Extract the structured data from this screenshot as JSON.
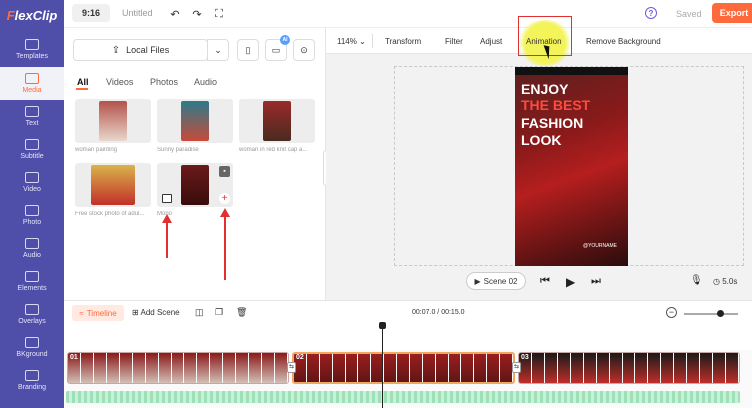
{
  "app": {
    "logo_prefix": "F",
    "logo_rest": "lexClip"
  },
  "topbar": {
    "ratio": "9:16",
    "title": "Untitled",
    "help": "?",
    "saved": "Saved",
    "export": "Export"
  },
  "sidebar": {
    "items": [
      {
        "label": "Templates"
      },
      {
        "label": "Media"
      },
      {
        "label": "Text"
      },
      {
        "label": "Subtitle"
      },
      {
        "label": "Video"
      },
      {
        "label": "Photo"
      },
      {
        "label": "Audio"
      },
      {
        "label": "Elements"
      },
      {
        "label": "Overlays"
      },
      {
        "label": "BKground"
      },
      {
        "label": "Branding"
      }
    ]
  },
  "media": {
    "local_files": "Local Files",
    "ai_badge": "AI",
    "tabs": [
      "All",
      "Videos",
      "Photos",
      "Audio"
    ],
    "items": [
      {
        "caption": "woman painting"
      },
      {
        "caption": "Sunny paradise"
      },
      {
        "caption": "woman in red knit cap a..."
      },
      {
        "caption": "Free stock photo of adul..."
      },
      {
        "caption": "Mono"
      }
    ]
  },
  "toolbar": {
    "zoom": "114%",
    "items": [
      "Transform",
      "Filter",
      "Adjust",
      "Animation",
      "Remove Background"
    ]
  },
  "preview": {
    "line1": "ENJOY",
    "line2": "THE BEST",
    "line3": "FASHION",
    "line4": "LOOK",
    "tag": "@YOURNAME"
  },
  "player": {
    "scene": "Scene 02",
    "duration": "5.0s"
  },
  "timeline": {
    "label": "Timeline",
    "add_scene": "Add Scene",
    "timecode": "00:07.0 / 00:15.0",
    "clips": [
      "01",
      "02",
      "03"
    ]
  },
  "colors": {
    "accent": "#ff6a3d",
    "sidebar": "#4f4ea8",
    "highlight": "#e03030"
  }
}
